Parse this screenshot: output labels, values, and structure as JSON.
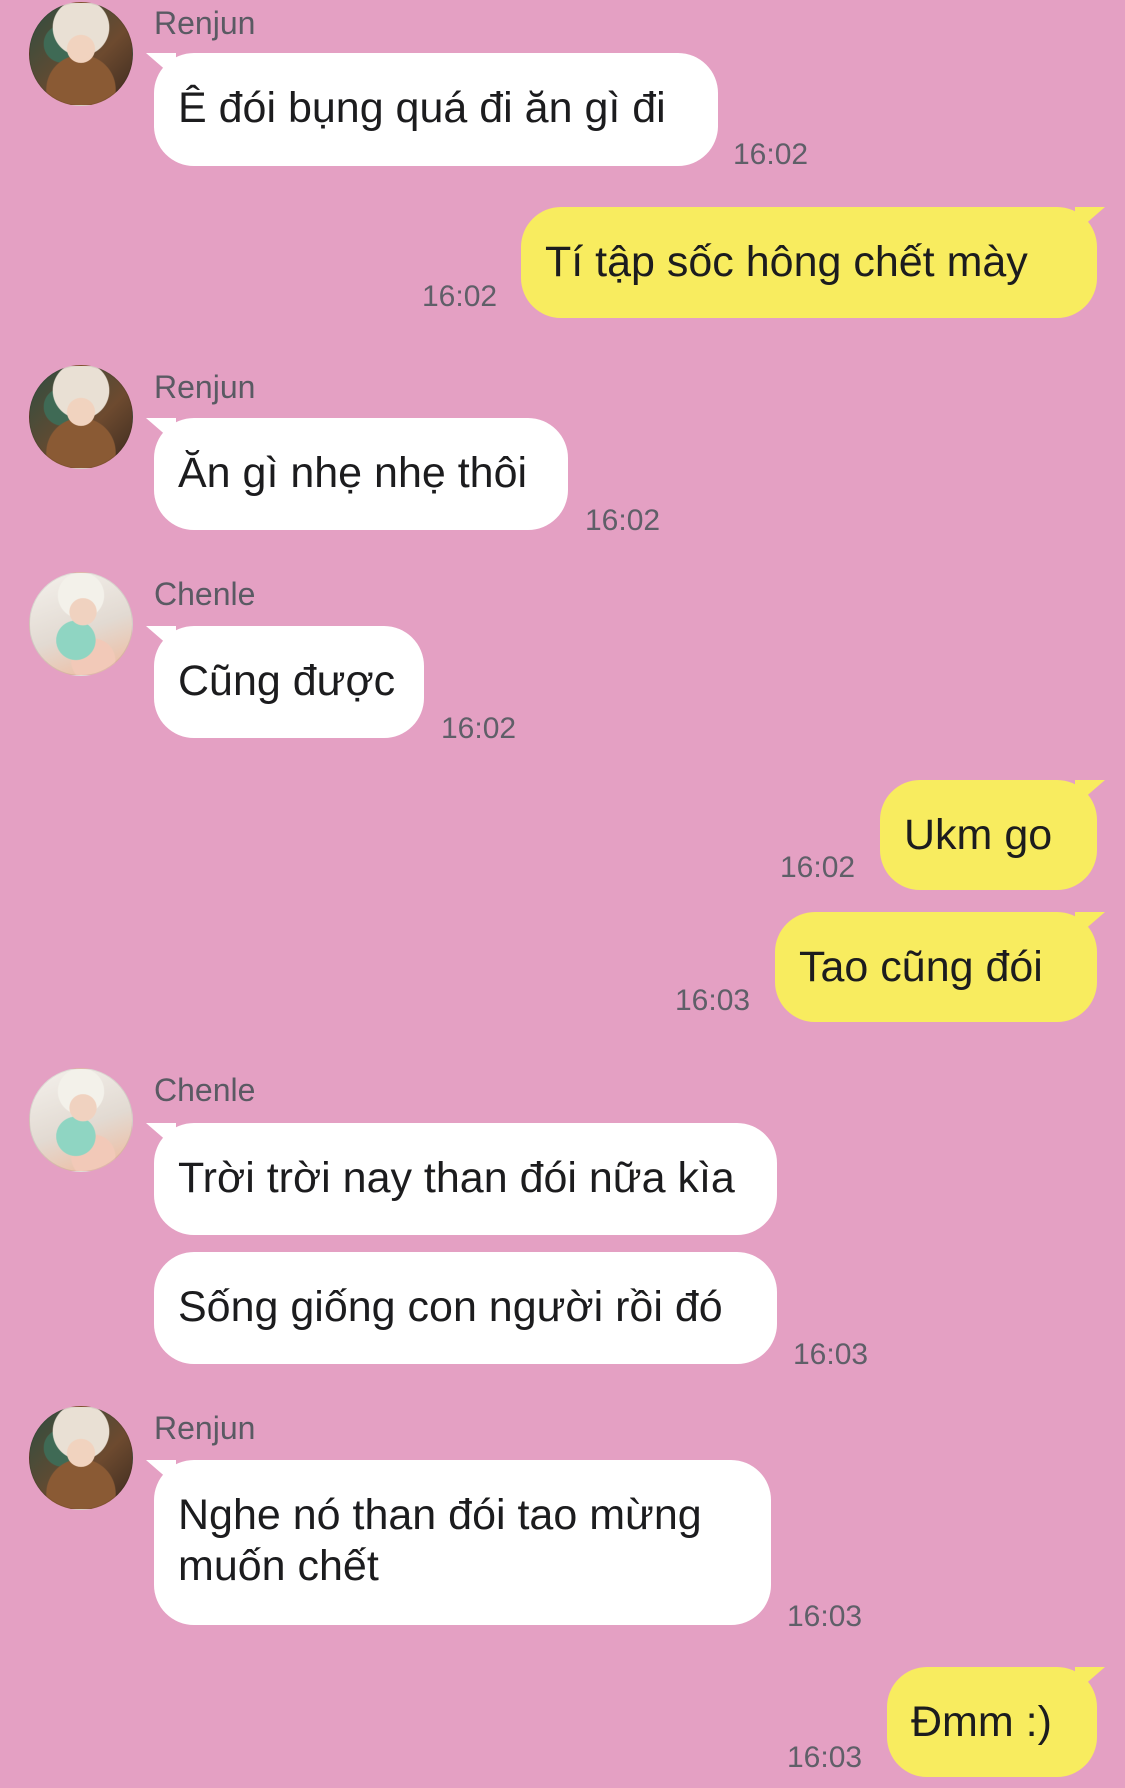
{
  "colors": {
    "background": "#e4a0c3",
    "incoming_bubble": "#ffffff",
    "outgoing_bubble": "#f8ec5f",
    "text": "#1c1c1e",
    "meta_text": "#5f5f68"
  },
  "icons": {
    "renjun_avatar": "profile-photo",
    "chenle_avatar": "profile-photo"
  },
  "messages": [
    {
      "sender": "Renjun",
      "text": "Ê đói bụng quá đi ăn gì đi",
      "time": "16:02"
    },
    {
      "sender": "me",
      "text": "Tí tập sốc hông chết mày",
      "time": "16:02"
    },
    {
      "sender": "Renjun",
      "text": "Ăn gì nhẹ nhẹ thôi",
      "time": "16:02"
    },
    {
      "sender": "Chenle",
      "text": "Cũng được",
      "time": "16:02"
    },
    {
      "sender": "me",
      "text": "Ukm go",
      "time": "16:02"
    },
    {
      "sender": "me",
      "text": "Tao cũng đói",
      "time": "16:03"
    },
    {
      "sender": "Chenle",
      "text": "Trời trời nay than đói nữa kìa",
      "time": ""
    },
    {
      "sender": "Chenle",
      "text": "Sống giống con người rồi đó",
      "time": "16:03"
    },
    {
      "sender": "Renjun",
      "text": "Nghe nó than đói tao mừng muốn chết",
      "time": "16:03"
    },
    {
      "sender": "me",
      "text": "Đmm :)",
      "time": "16:03"
    }
  ]
}
